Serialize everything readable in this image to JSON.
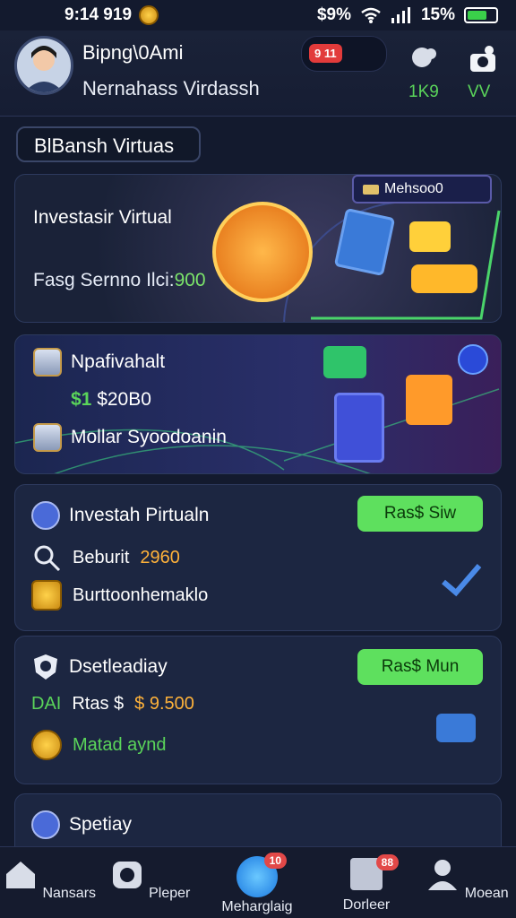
{
  "status": {
    "time": "9:14 919",
    "battery_text": "$9% ",
    "signal_text": "15%"
  },
  "header": {
    "name": "Bipng\\0Ami",
    "subtitle": "Nernahass Virdassh",
    "badge": "9 11",
    "stat1": "1K9",
    "stat2": "VV"
  },
  "section_label": "BlBansh Virtuas",
  "card1": {
    "title": "Investasir Virtual",
    "subtitle_prefix": "Fasg Sernno Ilci:",
    "subtitle_value": "900",
    "tag": "Mehsoo0"
  },
  "card2": {
    "row1": "Npafivahalt",
    "amount_prefix": "$1",
    "amount": "$20B0",
    "row2": "Mollar Syoodoanin"
  },
  "card3": {
    "title": "Investah Pirtualn",
    "button": "Ras$ Siw",
    "row1_label": "Beburit",
    "row1_value": "2960",
    "row2": "Burttoonhemaklo"
  },
  "card4": {
    "title": "Dsetleadiay",
    "button": "Ras$ Mun",
    "amount_prefix": "DAI",
    "amount_label": "Rtas $",
    "amount_value": "$ 9.500",
    "row2": "Matad aynd"
  },
  "card5": {
    "title": "Spetiay"
  },
  "nav": [
    {
      "label": "Nansars",
      "icon": "home-icon",
      "badge": ""
    },
    {
      "label": "Pleper",
      "icon": "camera-icon",
      "badge": ""
    },
    {
      "label": "Meharglaig",
      "icon": "chat-icon",
      "badge": "10"
    },
    {
      "label": "Dorleer",
      "icon": "gift-icon",
      "badge": "88"
    },
    {
      "label": "Moean",
      "icon": "profile-icon",
      "badge": ""
    }
  ],
  "colors": {
    "bg": "#131a2e",
    "accent_green": "#5ee05e",
    "card": "#1c2641",
    "alert": "#e23b3b"
  }
}
